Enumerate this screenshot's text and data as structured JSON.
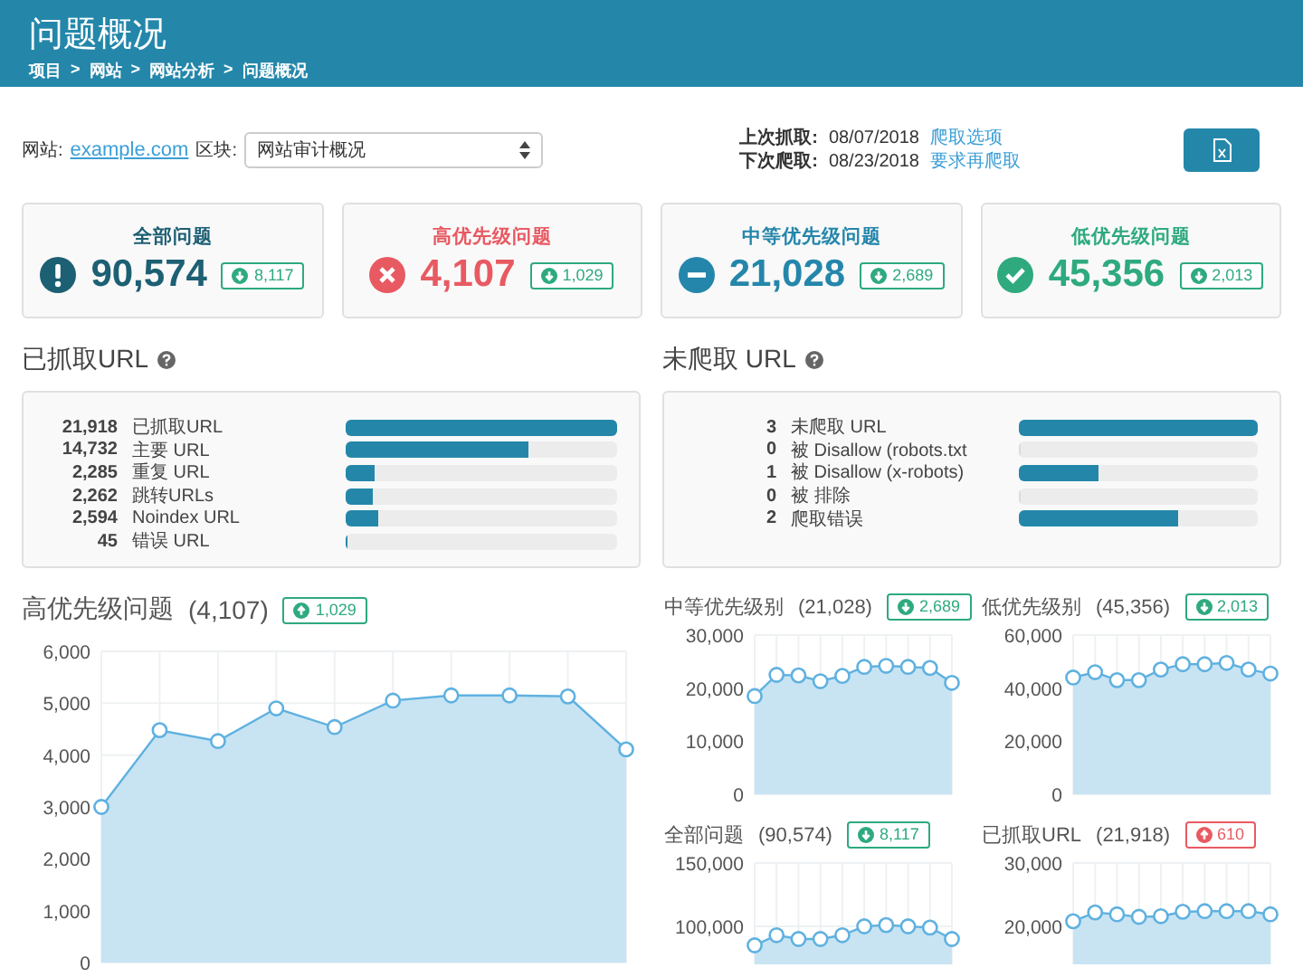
{
  "header": {
    "title": "问题概况",
    "breadcrumb": [
      "项目",
      "网站",
      "网站分析",
      "问题概况"
    ],
    "separator": ">"
  },
  "toolbar": {
    "site_label": "网站:",
    "site_link": "example.com",
    "section_label": "区块:",
    "section_select": "网站审计概况",
    "last_crawl_label": "上次抓取:",
    "last_crawl_date": "08/07/2018",
    "crawl_options_link": "爬取选项",
    "next_crawl_label": "下次爬取:",
    "next_crawl_date": "08/23/2018",
    "recrawl_link": "要求再爬取"
  },
  "summary_cards": [
    {
      "kind": "all",
      "title": "全部问题",
      "value": "90,574",
      "color": "#1d5f73",
      "badge": {
        "text": "8,117",
        "color": "#2eaa7e"
      }
    },
    {
      "kind": "high",
      "title": "高优先级问题",
      "value": "4,107",
      "color": "#e85a62",
      "badge": {
        "text": "1,029",
        "color": "#2eaa7e"
      }
    },
    {
      "kind": "medium",
      "title": "中等优先级问题",
      "value": "21,028",
      "color": "#2586ab",
      "badge": {
        "text": "2,689",
        "color": "#2eaa7e"
      }
    },
    {
      "kind": "low",
      "title": "低优先级问题",
      "value": "45,356",
      "color": "#2eaa7e",
      "badge": {
        "text": "2,013",
        "color": "#2eaa7e"
      }
    }
  ],
  "panels": [
    {
      "title": "已抓取URL",
      "rows": [
        {
          "count": "21,918",
          "label": "已抓取URL",
          "level": 1
        },
        {
          "count": "14,732",
          "label": "主要 URL",
          "level": 0.672
        },
        {
          "count": "2,285",
          "label": "重复 URL",
          "level": 0.104
        },
        {
          "count": "2,262",
          "label": "跳转URLs",
          "level": 0.103
        },
        {
          "count": "2,594",
          "label": "Noindex URL",
          "level": 0.118
        },
        {
          "count": "45",
          "label": "错误 URL",
          "level": 0.003
        }
      ]
    },
    {
      "title": "未爬取 URL",
      "rows": [
        {
          "count": "3",
          "label": "未爬取 URL",
          "level": 1
        },
        {
          "count": "0",
          "label": "被 Disallow (robots.txt",
          "level": 0
        },
        {
          "count": "1",
          "label": "被 Disallow (x-robots)",
          "level": 0.333
        },
        {
          "count": "0",
          "label": "被 排除",
          "level": 0
        },
        {
          "count": "2",
          "label": "爬取错误",
          "level": 0.667
        }
      ]
    }
  ],
  "main_chart": {
    "title": "高优先级问题",
    "count": "(4,107)",
    "badge": {
      "text": "1,029",
      "color": "#2eaa7e"
    },
    "chart_data": {
      "type": "area",
      "grid": true,
      "ylim": [
        0,
        6000
      ],
      "yticks": [
        {
          "value": 0,
          "label": "0"
        },
        {
          "value": 1000,
          "label": "1,000"
        },
        {
          "value": 2000,
          "label": "2,000"
        },
        {
          "value": 3000,
          "label": "3,000"
        },
        {
          "value": 4000,
          "label": "4,000"
        },
        {
          "value": 5000,
          "label": "5,000"
        },
        {
          "value": 6000,
          "label": "6,000"
        }
      ],
      "values": [
        3000,
        4480,
        4270,
        4900,
        4540,
        5050,
        5150,
        5150,
        5130,
        4110
      ]
    }
  },
  "small_charts": [
    {
      "title": "中等优先级别",
      "count": "(21,028)",
      "badge": {
        "text": "2,689",
        "color": "#2eaa7e"
      },
      "chart_data": {
        "type": "area",
        "grid": true,
        "ylim": [
          0,
          30000
        ],
        "yticks": [
          {
            "value": 0,
            "label": "0"
          },
          {
            "value": 10000,
            "label": "10,000"
          },
          {
            "value": 20000,
            "label": "20,000"
          },
          {
            "value": 30000,
            "label": "30,000"
          }
        ],
        "values": [
          18500,
          22500,
          22400,
          21300,
          22300,
          24000,
          24200,
          24000,
          23800,
          21000
        ]
      }
    },
    {
      "title": "低优先级别",
      "count": "(45,356)",
      "badge": {
        "text": "2,013",
        "color": "#2eaa7e"
      },
      "chart_data": {
        "type": "area",
        "grid": true,
        "ylim": [
          0,
          60000
        ],
        "yticks": [
          {
            "value": 0,
            "label": "0"
          },
          {
            "value": 20000,
            "label": "20,000"
          },
          {
            "value": 40000,
            "label": "40,000"
          },
          {
            "value": 60000,
            "label": "60,000"
          }
        ],
        "values": [
          44000,
          46000,
          43000,
          43000,
          47000,
          49000,
          49000,
          49500,
          47000,
          45500
        ]
      }
    },
    {
      "title": "全部问题",
      "count": "(90,574)",
      "badge": {
        "text": "8,117",
        "color": "#2eaa7e"
      },
      "chart_data": {
        "type": "area",
        "grid": true,
        "ylim": [
          70000,
          150000
        ],
        "yticks": [
          {
            "value": 100000,
            "label": "100,000"
          },
          {
            "value": 150000,
            "label": "150,000"
          }
        ],
        "values": [
          85000,
          93000,
          90000,
          90000,
          93000,
          100000,
          101000,
          100000,
          99000,
          90000
        ]
      }
    },
    {
      "title": "已抓取URL",
      "count": "(21,918)",
      "badge": {
        "text": "610",
        "color": "#e85a62"
      },
      "chart_data": {
        "type": "area",
        "grid": true,
        "ylim": [
          14000,
          30000
        ],
        "yticks": [
          {
            "value": 20000,
            "label": "20,000"
          },
          {
            "value": 30000,
            "label": "30,000"
          }
        ],
        "values": [
          20800,
          22200,
          21900,
          21500,
          21600,
          22300,
          22400,
          22400,
          22400,
          21900
        ]
      }
    }
  ]
}
